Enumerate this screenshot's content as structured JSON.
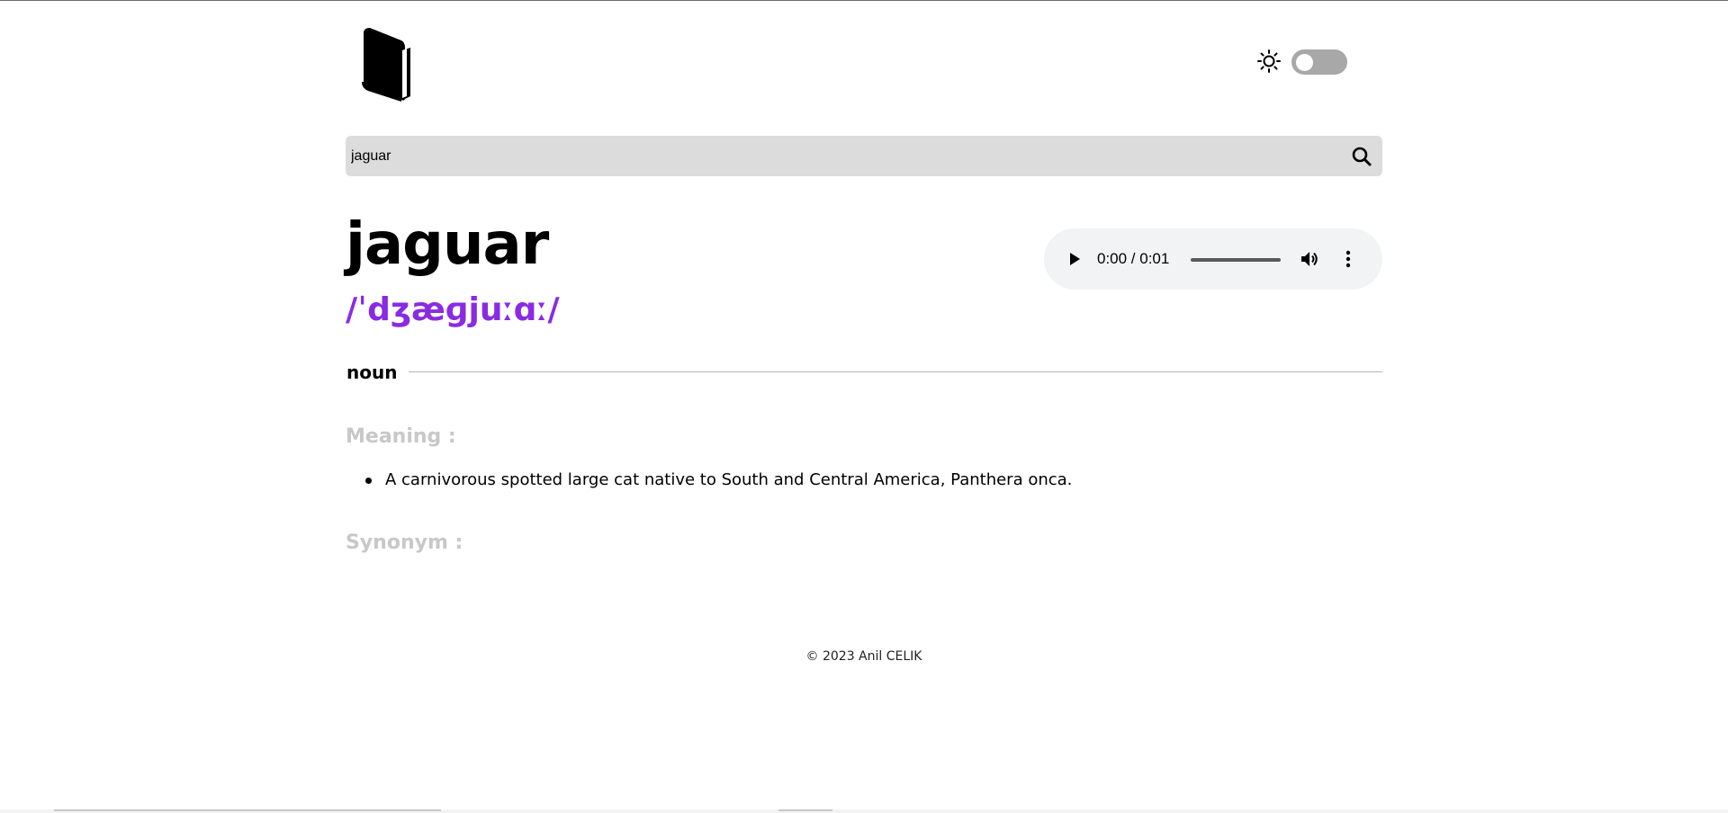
{
  "search": {
    "value": "jaguar",
    "placeholder": ""
  },
  "entry": {
    "word": "jaguar",
    "phonetic": "/ˈdʒæɡjuːɑː/",
    "part_of_speech": "noun",
    "meaning_title": "Meaning :",
    "meanings": [
      "A carnivorous spotted large cat native to South and Central America, Panthera onca."
    ],
    "synonym_title": "Synonym :"
  },
  "audio": {
    "time": "0:00 / 0:01"
  },
  "theme": {
    "mode": "light"
  },
  "footer": {
    "text": "© 2023 Anil CELIK"
  },
  "colors": {
    "accent": "#8a2be2",
    "muted_heading": "#c8c8c8",
    "search_bg": "#dcdcdc",
    "toggle_bg": "#a8a8a8"
  },
  "icons": {
    "logo": "book-icon",
    "light": "sun-icon",
    "dark": "moon-icon",
    "search": "search-icon",
    "play": "play-icon",
    "volume": "volume-icon",
    "more": "more-vertical-icon"
  }
}
